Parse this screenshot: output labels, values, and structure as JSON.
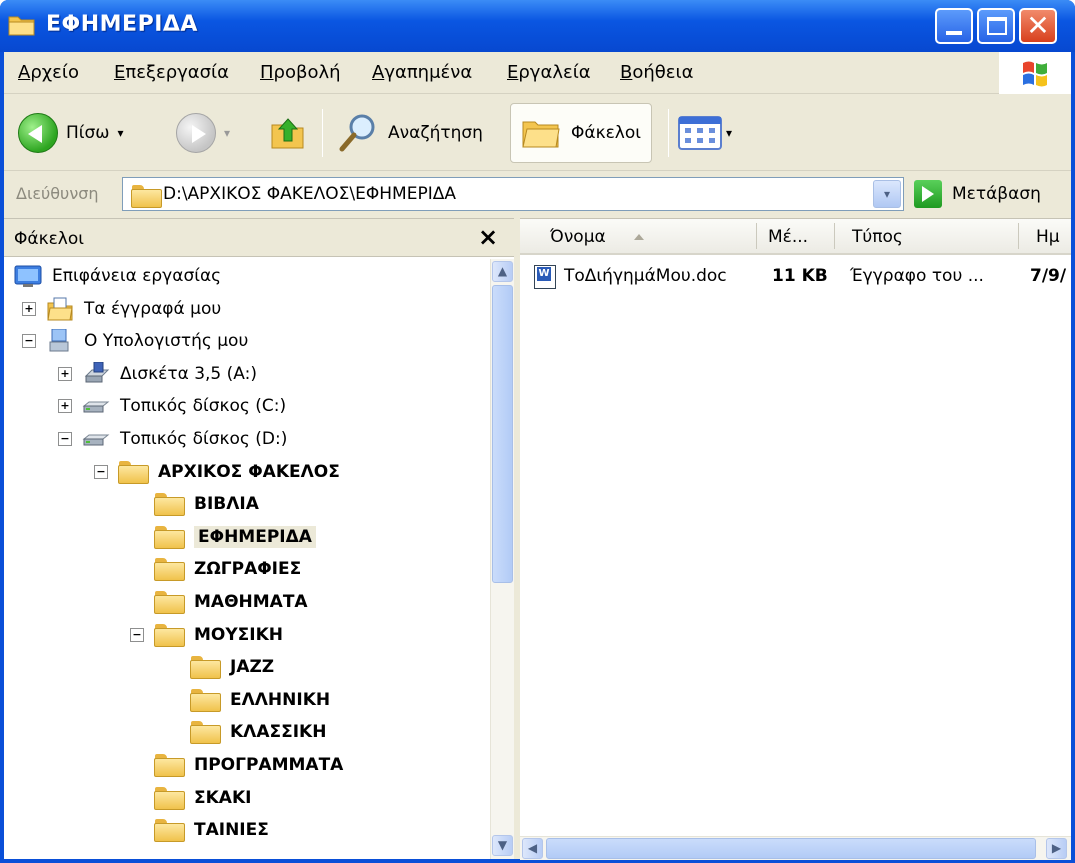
{
  "window": {
    "title": "ΕΦΗΜΕΡΙΔΑ",
    "minimize_icon": "minimize-icon",
    "maximize_icon": "maximize-icon",
    "close_glyph": "✕"
  },
  "menu": {
    "items": [
      "Αρχείο",
      "Επεξεργασία",
      "Προβολή",
      "Αγαπημένα",
      "Εργαλεία",
      "Βοήθεια"
    ]
  },
  "toolbar": {
    "back_label": "Πίσω",
    "search_label": "Αναζήτηση",
    "folders_label": "Φάκελοι",
    "dropdown_glyph": "▾"
  },
  "address": {
    "label": "Διεύθυνση",
    "path": "D:\\ΑΡΧΙΚΟΣ ΦΑΚΕΛΟΣ\\ΕΦΗΜΕΡΙΔΑ",
    "go_label": "Μετάβαση",
    "dropdown_glyph": "▾"
  },
  "folders_pane": {
    "title": "Φάκελοι",
    "close_glyph": "×",
    "tree": [
      {
        "label": "Επιφάνεια εργασίας",
        "icon": "desktop-icon",
        "expander": ""
      },
      {
        "label": "Τα έγγραφά μου",
        "icon": "my-documents-icon",
        "expander": "+"
      },
      {
        "label": "Ο Υπολογιστής μου",
        "icon": "my-computer-icon",
        "expander": "−"
      },
      {
        "label": "Δισκέτα 3,5 (A:)",
        "icon": "floppy-drive-icon",
        "expander": "+"
      },
      {
        "label": "Τοπικός δίσκος (C:)",
        "icon": "hard-drive-icon",
        "expander": "+"
      },
      {
        "label": "Τοπικός δίσκος (D:)",
        "icon": "hard-drive-icon",
        "expander": "−"
      },
      {
        "label": "ΑΡΧΙΚΟΣ ΦΑΚΕΛΟΣ",
        "icon": "folder-icon",
        "expander": "−"
      },
      {
        "label": "ΒΙΒΛΙΑ",
        "icon": "folder-icon",
        "expander": ""
      },
      {
        "label": "ΕΦΗΜΕΡΙΔΑ",
        "icon": "folder-icon",
        "expander": "",
        "selected": true
      },
      {
        "label": "ΖΩΓΡΑΦΙΕΣ",
        "icon": "folder-icon",
        "expander": ""
      },
      {
        "label": "ΜΑΘΗΜΑΤΑ",
        "icon": "folder-icon",
        "expander": ""
      },
      {
        "label": "ΜΟΥΣΙΚΗ",
        "icon": "folder-icon",
        "expander": "−"
      },
      {
        "label": "JAZZ",
        "icon": "folder-icon",
        "expander": ""
      },
      {
        "label": "ΕΛΛΗΝΙΚΗ",
        "icon": "folder-icon",
        "expander": ""
      },
      {
        "label": "ΚΛΑΣΣΙΚΗ",
        "icon": "folder-icon",
        "expander": ""
      },
      {
        "label": "ΠΡΟΓΡΑΜΜΑΤΑ",
        "icon": "folder-icon",
        "expander": ""
      },
      {
        "label": "ΣΚΑΚΙ",
        "icon": "folder-icon",
        "expander": ""
      },
      {
        "label": "ΤΑΙΝΙΕΣ",
        "icon": "folder-icon",
        "expander": ""
      }
    ]
  },
  "file_list": {
    "columns": [
      "Όνομα",
      "Μέ...",
      "Τύπος",
      "Ημ"
    ],
    "files": [
      {
        "name": "ΤοΔιήγημάΜου.doc",
        "size": "11 KB",
        "type": "Έγγραφο του ...",
        "date": "7/9/",
        "icon": "word-document-icon"
      }
    ]
  },
  "scroll": {
    "up": "▲",
    "down": "▼",
    "left": "◀",
    "right": "▶"
  }
}
